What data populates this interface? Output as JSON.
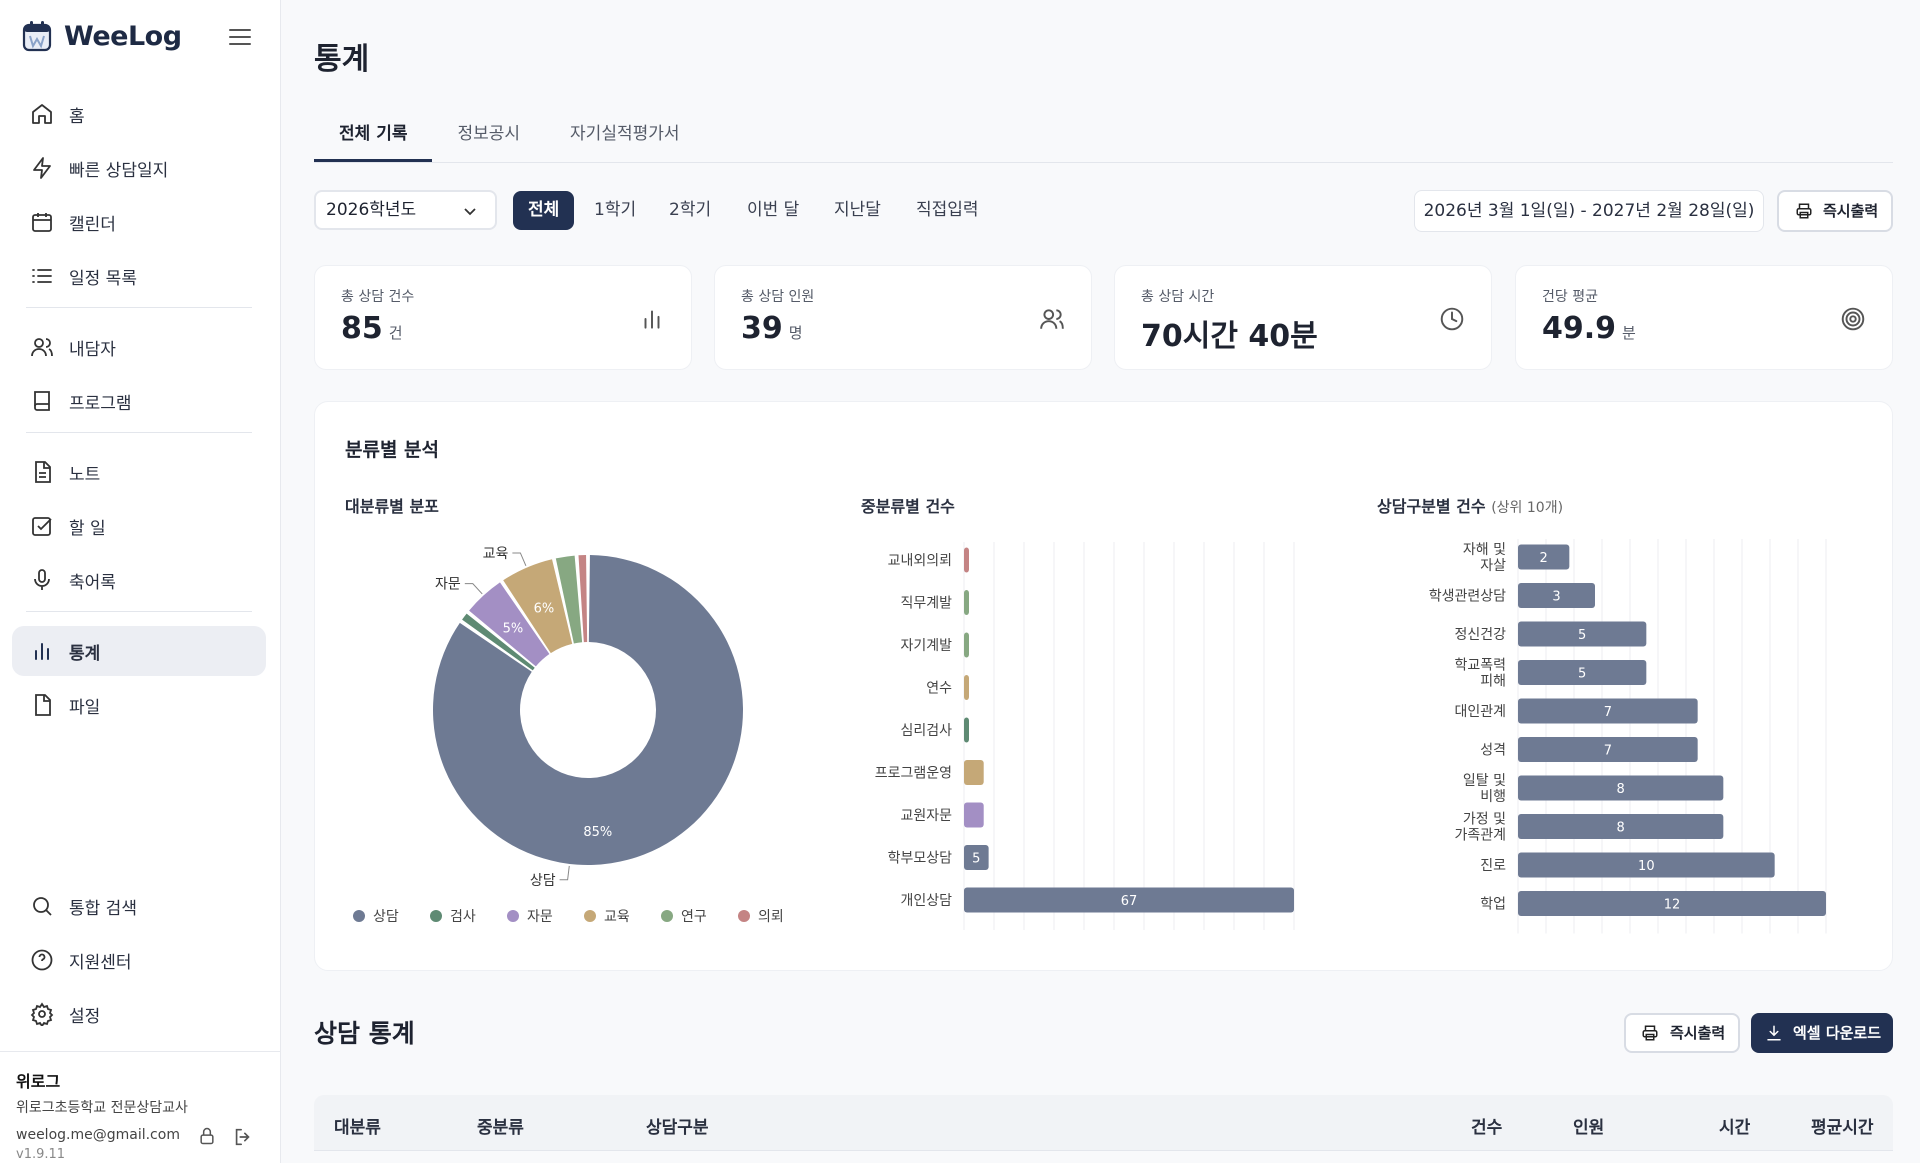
{
  "app": {
    "name": "WeeLog"
  },
  "nav": {
    "items": [
      {
        "label": "홈",
        "icon": "home-icon"
      },
      {
        "label": "빠른 상담일지",
        "icon": "bolt-icon"
      },
      {
        "label": "캘린더",
        "icon": "calendar-icon"
      },
      {
        "label": "일정 목록",
        "icon": "list-icon"
      },
      {
        "label": "내담자",
        "icon": "users-icon"
      },
      {
        "label": "프로그램",
        "icon": "book-icon"
      },
      {
        "label": "노트",
        "icon": "note-icon"
      },
      {
        "label": "할 일",
        "icon": "checkbox-icon"
      },
      {
        "label": "축어록",
        "icon": "mic-icon"
      },
      {
        "label": "통계",
        "icon": "bar-chart-icon",
        "active": true
      },
      {
        "label": "파일",
        "icon": "file-icon"
      }
    ],
    "bottom": [
      {
        "label": "통합 검색",
        "icon": "search-icon"
      },
      {
        "label": "지원센터",
        "icon": "help-icon"
      },
      {
        "label": "설정",
        "icon": "gear-icon"
      }
    ]
  },
  "profile": {
    "name": "위로그",
    "school": "위로그초등학교 전문상담교사",
    "email": "weelog.me@gmail.com",
    "version": "v1.9.11"
  },
  "page": {
    "title": "통계"
  },
  "tabs": [
    "전체 기록",
    "정보공시",
    "자기실적평가서"
  ],
  "filters": {
    "year": "2026학년도",
    "periods": [
      "전체",
      "1학기",
      "2학기",
      "이번 달",
      "지난달",
      "직접입력"
    ],
    "date_range": "2026년 3월 1일(일) - 2027년 2월 28일(일)",
    "print_label": "즉시출력"
  },
  "stats": [
    {
      "label": "총 상담 건수",
      "value": "85",
      "unit": "건",
      "icon": "bar-chart-icon"
    },
    {
      "label": "총 상담 인원",
      "value": "39",
      "unit": "명",
      "icon": "users-icon"
    },
    {
      "label": "총 상담 시간",
      "value": "70시간 40분",
      "unit": "",
      "icon": "clock-icon"
    },
    {
      "label": "건당 평균",
      "value": "49.9",
      "unit": "분",
      "icon": "target-icon"
    }
  ],
  "analysis": {
    "title": "분류별 분석",
    "pie_title": "대분류별 분포",
    "mid_title": "중분류별 건수",
    "type_title": "상담구분별 건수",
    "type_note": "(상위 10개)"
  },
  "colors": {
    "상담": "#6e7a93",
    "검사": "#5e8a73",
    "자문": "#a38fc4",
    "교육": "#c5a877",
    "연구": "#87a882",
    "의뢰": "#c48484",
    "accent": "#223152"
  },
  "chart_data": [
    {
      "type": "pie",
      "title": "대분류별 분포",
      "categories": [
        "상담",
        "검사",
        "자문",
        "교육",
        "연구",
        "의뢰"
      ],
      "values": [
        72,
        1,
        4,
        5,
        2,
        1
      ],
      "data_labels": [
        "85%",
        "",
        "5%",
        "6%",
        "",
        ""
      ],
      "callouts": [
        "상담",
        "",
        "자문",
        "교육",
        "",
        ""
      ],
      "legend": "bottom"
    },
    {
      "type": "bar",
      "orientation": "horizontal",
      "title": "중분류별 건수",
      "categories": [
        "교내외의뢰",
        "직무계발",
        "자기계발",
        "연수",
        "심리검사",
        "프로그램운영",
        "교원자문",
        "학부모상담",
        "개인상담"
      ],
      "values": [
        1,
        1,
        1,
        1,
        1,
        4,
        4,
        5,
        67
      ],
      "groups": [
        "의뢰",
        "연구",
        "연구",
        "교육",
        "검사",
        "교육",
        "자문",
        "상담",
        "상담"
      ],
      "data_labels": [
        "",
        "",
        "",
        "",
        "",
        "",
        "",
        "5",
        "67"
      ],
      "xlim": [
        0,
        67
      ],
      "grid": true
    },
    {
      "type": "bar",
      "orientation": "horizontal",
      "title": "상담구분별 건수",
      "categories": [
        "자해 및\n자살",
        "학생관련상담",
        "정신건강",
        "학교폭력\n피해",
        "대인관계",
        "성격",
        "일탈 및\n비행",
        "가정 및\n가족관계",
        "진로",
        "학업"
      ],
      "values": [
        2,
        3,
        5,
        5,
        7,
        7,
        8,
        8,
        10,
        12
      ],
      "xlim": [
        0,
        12
      ],
      "grid": true
    }
  ],
  "counsel_stats": {
    "title": "상담 통계",
    "print_label": "즉시출력",
    "excel_label": "엑셀 다운로드",
    "columns": [
      "대분류",
      "중분류",
      "상담구분",
      "건수",
      "인원",
      "시간",
      "평균시간"
    ]
  }
}
